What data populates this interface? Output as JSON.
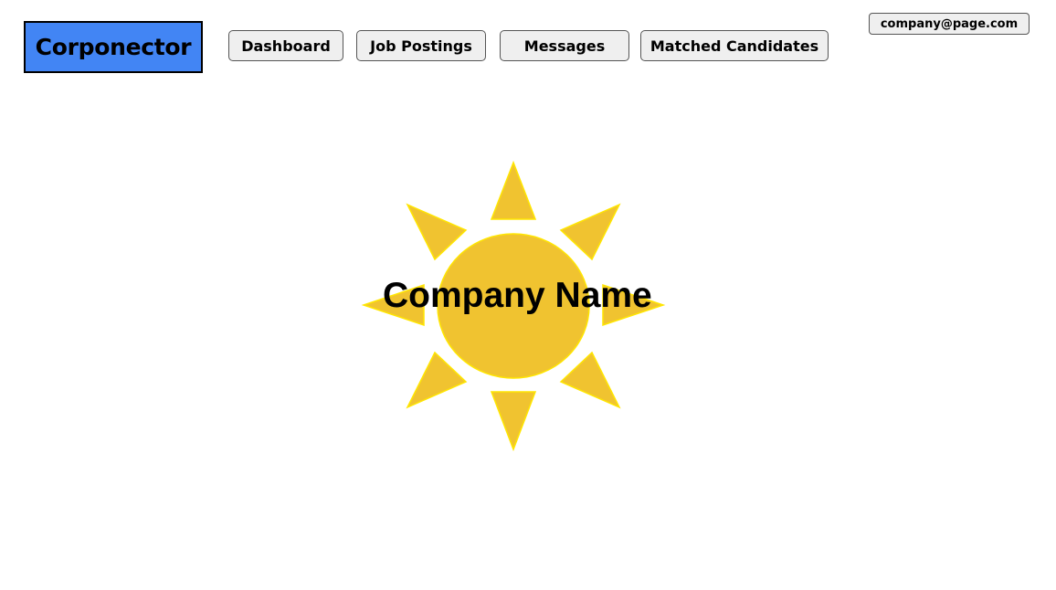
{
  "header": {
    "logo_text": "Corponector",
    "nav": {
      "dashboard": "Dashboard",
      "job_postings": "Job Postings",
      "messages": "Messages",
      "matched_candidates": "Matched Candidates"
    },
    "account_email": "company@page.com"
  },
  "main": {
    "company_name": "Company Name",
    "logo_icon": "sun-icon"
  },
  "colors": {
    "logo_bg": "#4285f4",
    "button_bg": "#efefef",
    "sun_fill": "#f0c330",
    "sun_stroke": "#ffe600"
  }
}
